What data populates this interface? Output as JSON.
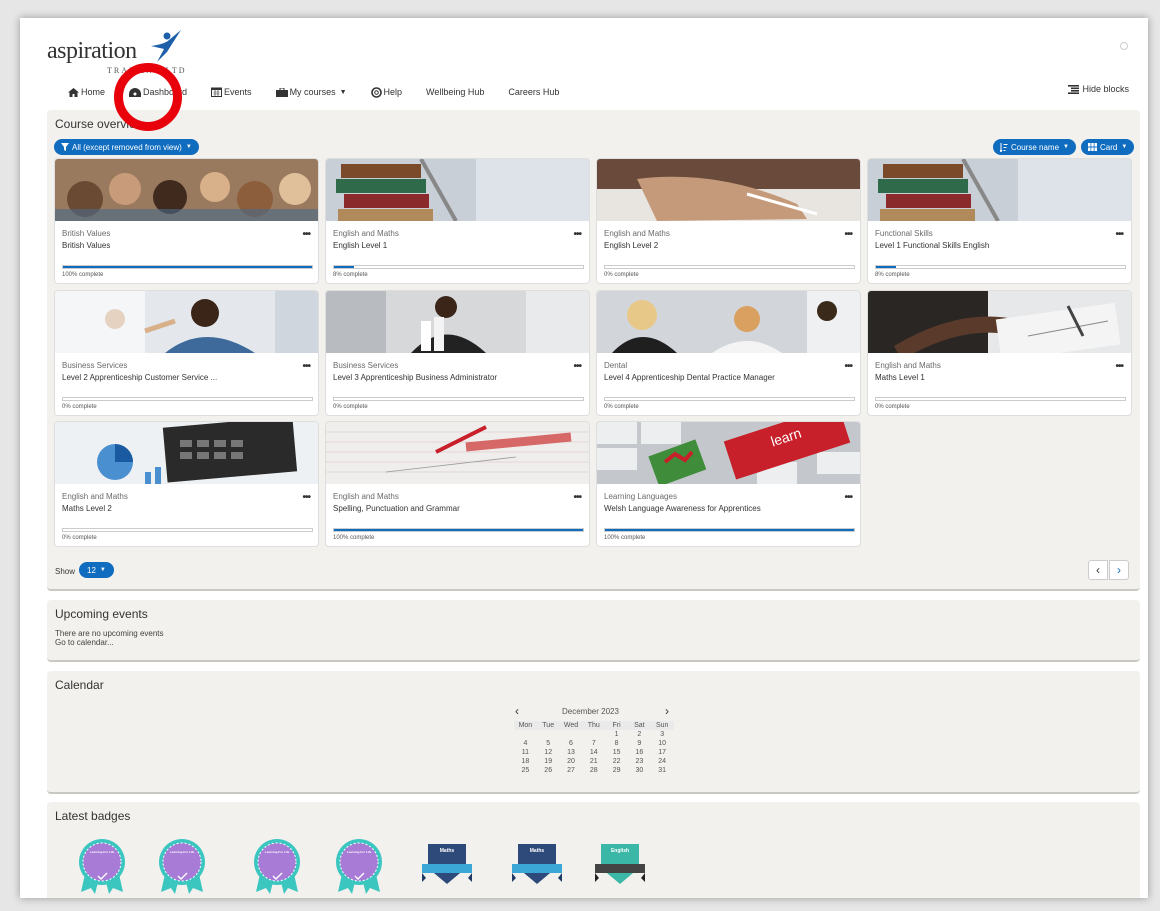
{
  "brand": {
    "logo_text": "aspiration",
    "logo_sub": "TRAINING LTD"
  },
  "nav": {
    "items": [
      {
        "label": "Home",
        "icon": "home-icon"
      },
      {
        "label": "Dashboard",
        "icon": "dashboard-icon"
      },
      {
        "label": "Events",
        "icon": "calendar-icon"
      },
      {
        "label": "My courses",
        "icon": "briefcase-icon"
      },
      {
        "label": "Help",
        "icon": "lifebuoy-icon"
      },
      {
        "label": "Wellbeing Hub"
      },
      {
        "label": "Careers Hub"
      }
    ],
    "hide_blocks": "Hide blocks"
  },
  "course_overview": {
    "title": "Course overview",
    "filter": "All (except removed from view)",
    "sort": "Course name",
    "view": "Card",
    "show_label": "Show",
    "show_count": "12",
    "courses": [
      {
        "category": "British Values",
        "name": "British Values",
        "progress_text": "100% complete",
        "progress": 100
      },
      {
        "category": "English and Maths",
        "name": "English Level 1",
        "progress_text": "8% complete",
        "progress": 8
      },
      {
        "category": "English and Maths",
        "name": "English Level 2",
        "progress_text": "0% complete",
        "progress": 0
      },
      {
        "category": "Functional Skills",
        "name": "Level 1 Functional Skills English",
        "progress_text": "8% complete",
        "progress": 8
      },
      {
        "category": "Business Services",
        "name": "Level 2 Apprenticeship Customer Service ...",
        "progress_text": "0% complete",
        "progress": 0
      },
      {
        "category": "Business Services",
        "name": "Level 3 Apprenticeship Business Administrator",
        "progress_text": "0% complete",
        "progress": 0
      },
      {
        "category": "Dental",
        "name": "Level 4 Apprenticeship Dental Practice Manager",
        "progress_text": "0% complete",
        "progress": 0
      },
      {
        "category": "English and Maths",
        "name": "Maths Level 1",
        "progress_text": "0% complete",
        "progress": 0
      },
      {
        "category": "English and Maths",
        "name": "Maths Level 2",
        "progress_text": "0% complete",
        "progress": 0
      },
      {
        "category": "English and Maths",
        "name": "Spelling, Punctuation and Grammar",
        "progress_text": "100% complete",
        "progress": 100
      },
      {
        "category": "Learning Languages",
        "name": "Welsh Language Awareness for Apprentices",
        "progress_text": "100% complete",
        "progress": 100
      }
    ]
  },
  "upcoming_events": {
    "title": "Upcoming events",
    "empty_text": "There are no upcoming events",
    "link": "Go to calendar..."
  },
  "calendar": {
    "title": "Calendar",
    "month": "December 2023",
    "days": [
      "Mon",
      "Tue",
      "Wed",
      "Thu",
      "Fri",
      "Sat",
      "Sun"
    ],
    "weeks": [
      [
        "",
        "",
        "",
        "",
        "1",
        "2",
        "3"
      ],
      [
        "4",
        "5",
        "6",
        "7",
        "8",
        "9",
        "10"
      ],
      [
        "11",
        "12",
        "13",
        "14",
        "15",
        "16",
        "17"
      ],
      [
        "18",
        "19",
        "20",
        "21",
        "22",
        "23",
        "24"
      ],
      [
        "25",
        "26",
        "27",
        "28",
        "29",
        "30",
        "31"
      ]
    ]
  },
  "latest_badges": {
    "title": "Latest badges",
    "badges": [
      {
        "header": "Learning For Life",
        "color": "#a87bd6",
        "ribbon": "#3cc6c0"
      },
      {
        "header": "Learning For Life",
        "color": "#a87bd6",
        "ribbon": "#3cc6c0"
      },
      {
        "header": "Learning For Life",
        "color": "#a87bd6",
        "ribbon": "#3cc6c0"
      },
      {
        "header": "Learning For Life",
        "color": "#a87bd6",
        "ribbon": "#3cc6c0"
      },
      {
        "header": "Maths",
        "color": "#2d4a7a",
        "ribbon": "#3aa7d6"
      },
      {
        "header": "Maths",
        "color": "#2d4a7a",
        "ribbon": "#3aa7d6"
      },
      {
        "header": "English",
        "color": "#3bb7a8",
        "ribbon": "#444444"
      }
    ]
  },
  "colors": {
    "accent": "#0f6cbf",
    "annotation": "#e8000b"
  }
}
